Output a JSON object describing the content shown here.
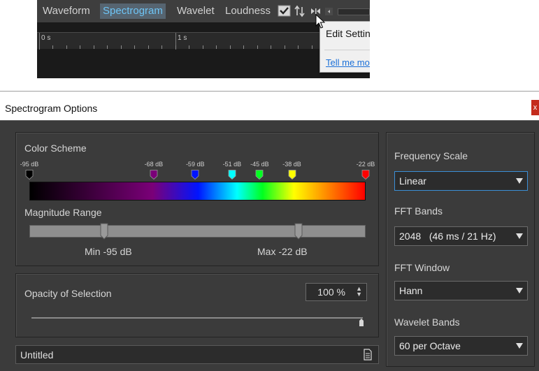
{
  "tabs": [
    "Waveform",
    "Spectrogram",
    "Wavelet",
    "Loudness"
  ],
  "active_tab": "Spectrogram",
  "ruler": {
    "labels": [
      "0 s",
      "1 s"
    ]
  },
  "context_menu": {
    "edit_settings": "Edit Settings...",
    "tell_me_more": "Tell me more"
  },
  "dialog": {
    "title": "Spectrogram Options",
    "close_label": "x",
    "color_scheme": {
      "label": "Color Scheme",
      "db_labels": [
        "-95 dB",
        "-68 dB",
        "-59 dB",
        "-51 dB",
        "-45 dB",
        "-38 dB",
        "-22 dB"
      ],
      "stop_colors": [
        "#000000",
        "#7a0078",
        "#0014ff",
        "#00ffff",
        "#00ff20",
        "#ffff00",
        "#ff0000"
      ]
    },
    "magnitude_range": {
      "label": "Magnitude Range",
      "min_label": "Min -95 dB",
      "max_label": "Max -22 dB",
      "min_db": -95,
      "max_db": -22
    },
    "opacity": {
      "label": "Opacity of Selection",
      "value": "100 %",
      "fraction": 1.0
    },
    "preset": {
      "name": "Untitled"
    },
    "frequency_scale": {
      "label": "Frequency Scale",
      "value": "Linear"
    },
    "fft_bands": {
      "label": "FFT Bands",
      "value": "2048   (46 ms / 21 Hz)"
    },
    "fft_window": {
      "label": "FFT Window",
      "value": "Hann"
    },
    "wavelet_bands": {
      "label": "Wavelet Bands",
      "value": "60 per Octave"
    }
  },
  "colors": {
    "accent": "#6ec5f6",
    "panel_bg": "#3b3b3b",
    "close_red": "#c42b1c",
    "link": "#1a6fd8"
  }
}
